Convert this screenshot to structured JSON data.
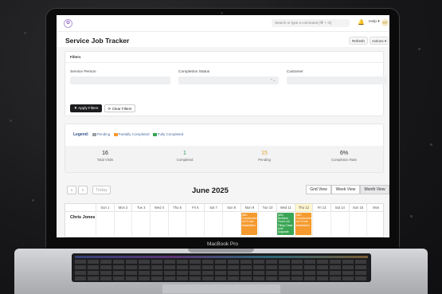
{
  "device": {
    "brand_label": "MacBook Pro"
  },
  "app": {
    "logo_glyph": "✿",
    "search_placeholder": "Search or type a command (⌘ + G)",
    "help_label": "Help",
    "help_caret": "▾",
    "avatar_initials": "SP"
  },
  "page": {
    "title": "Service Job Tracker",
    "refresh_label": "Refresh",
    "actions_label": "Actions",
    "actions_caret": "▾"
  },
  "filters": {
    "section_title": "Filters",
    "service_person_label": "Service Person",
    "service_person_value": "",
    "completion_status_label": "Completion Status",
    "completion_status_value": "",
    "completion_status_caret": "⌃⌄",
    "customer_label": "Customer",
    "customer_value": "",
    "apply_label": "▼ Apply Filters",
    "clear_label": "⟳ Clear Filters"
  },
  "legend": {
    "title": "Legend:",
    "items": [
      {
        "label": "Pending",
        "color": "#9aa0a6"
      },
      {
        "label": "Partially Completed",
        "color": "#f59a2e"
      },
      {
        "label": "Fully Completed",
        "color": "#3aa655"
      }
    ]
  },
  "stats": [
    {
      "value": "16",
      "label": "Total Visits",
      "color": "#2b2b2b"
    },
    {
      "value": "1",
      "label": "Completed",
      "color": "#2e9a52"
    },
    {
      "value": "15",
      "label": "Pending",
      "color": "#e0a32a"
    },
    {
      "value": "6%",
      "label": "Completion Rate",
      "color": "#2b2b2b"
    }
  ],
  "calendar": {
    "prev_label": "‹",
    "next_label": "›",
    "today_label": "Today",
    "month_title": "June 2025",
    "views": [
      {
        "label": "Grid View",
        "active": false
      },
      {
        "label": "Week View",
        "active": false
      },
      {
        "label": "Month View",
        "active": true
      }
    ],
    "days": [
      "Sun 1",
      "Mon 2",
      "Tue 3",
      "Wed 4",
      "Thu 5",
      "Fri 6",
      "Sat 7",
      "Sun 8",
      "Mon 9",
      "Tue 10",
      "Wed 11",
      "Thu 12",
      "Fri 13",
      "Sat 14",
      "Sun 15",
      "Mon"
    ],
    "highlight_day": "Thu 12",
    "person": "Chris Jones",
    "events": [
      {
        "day": "Mon 9",
        "text": "ABC Construction Ltd Trunk Installation",
        "color": "#f59a2e"
      },
      {
        "day": "Wed 11",
        "text": "ABC Builders Tours Ltd Tiling Class Unit Upgrade",
        "color": "#3aa655"
      },
      {
        "day": "Thu 12",
        "text": "ABC Construction Ltd Trunk Installation",
        "color": "#f59a2e"
      }
    ]
  }
}
